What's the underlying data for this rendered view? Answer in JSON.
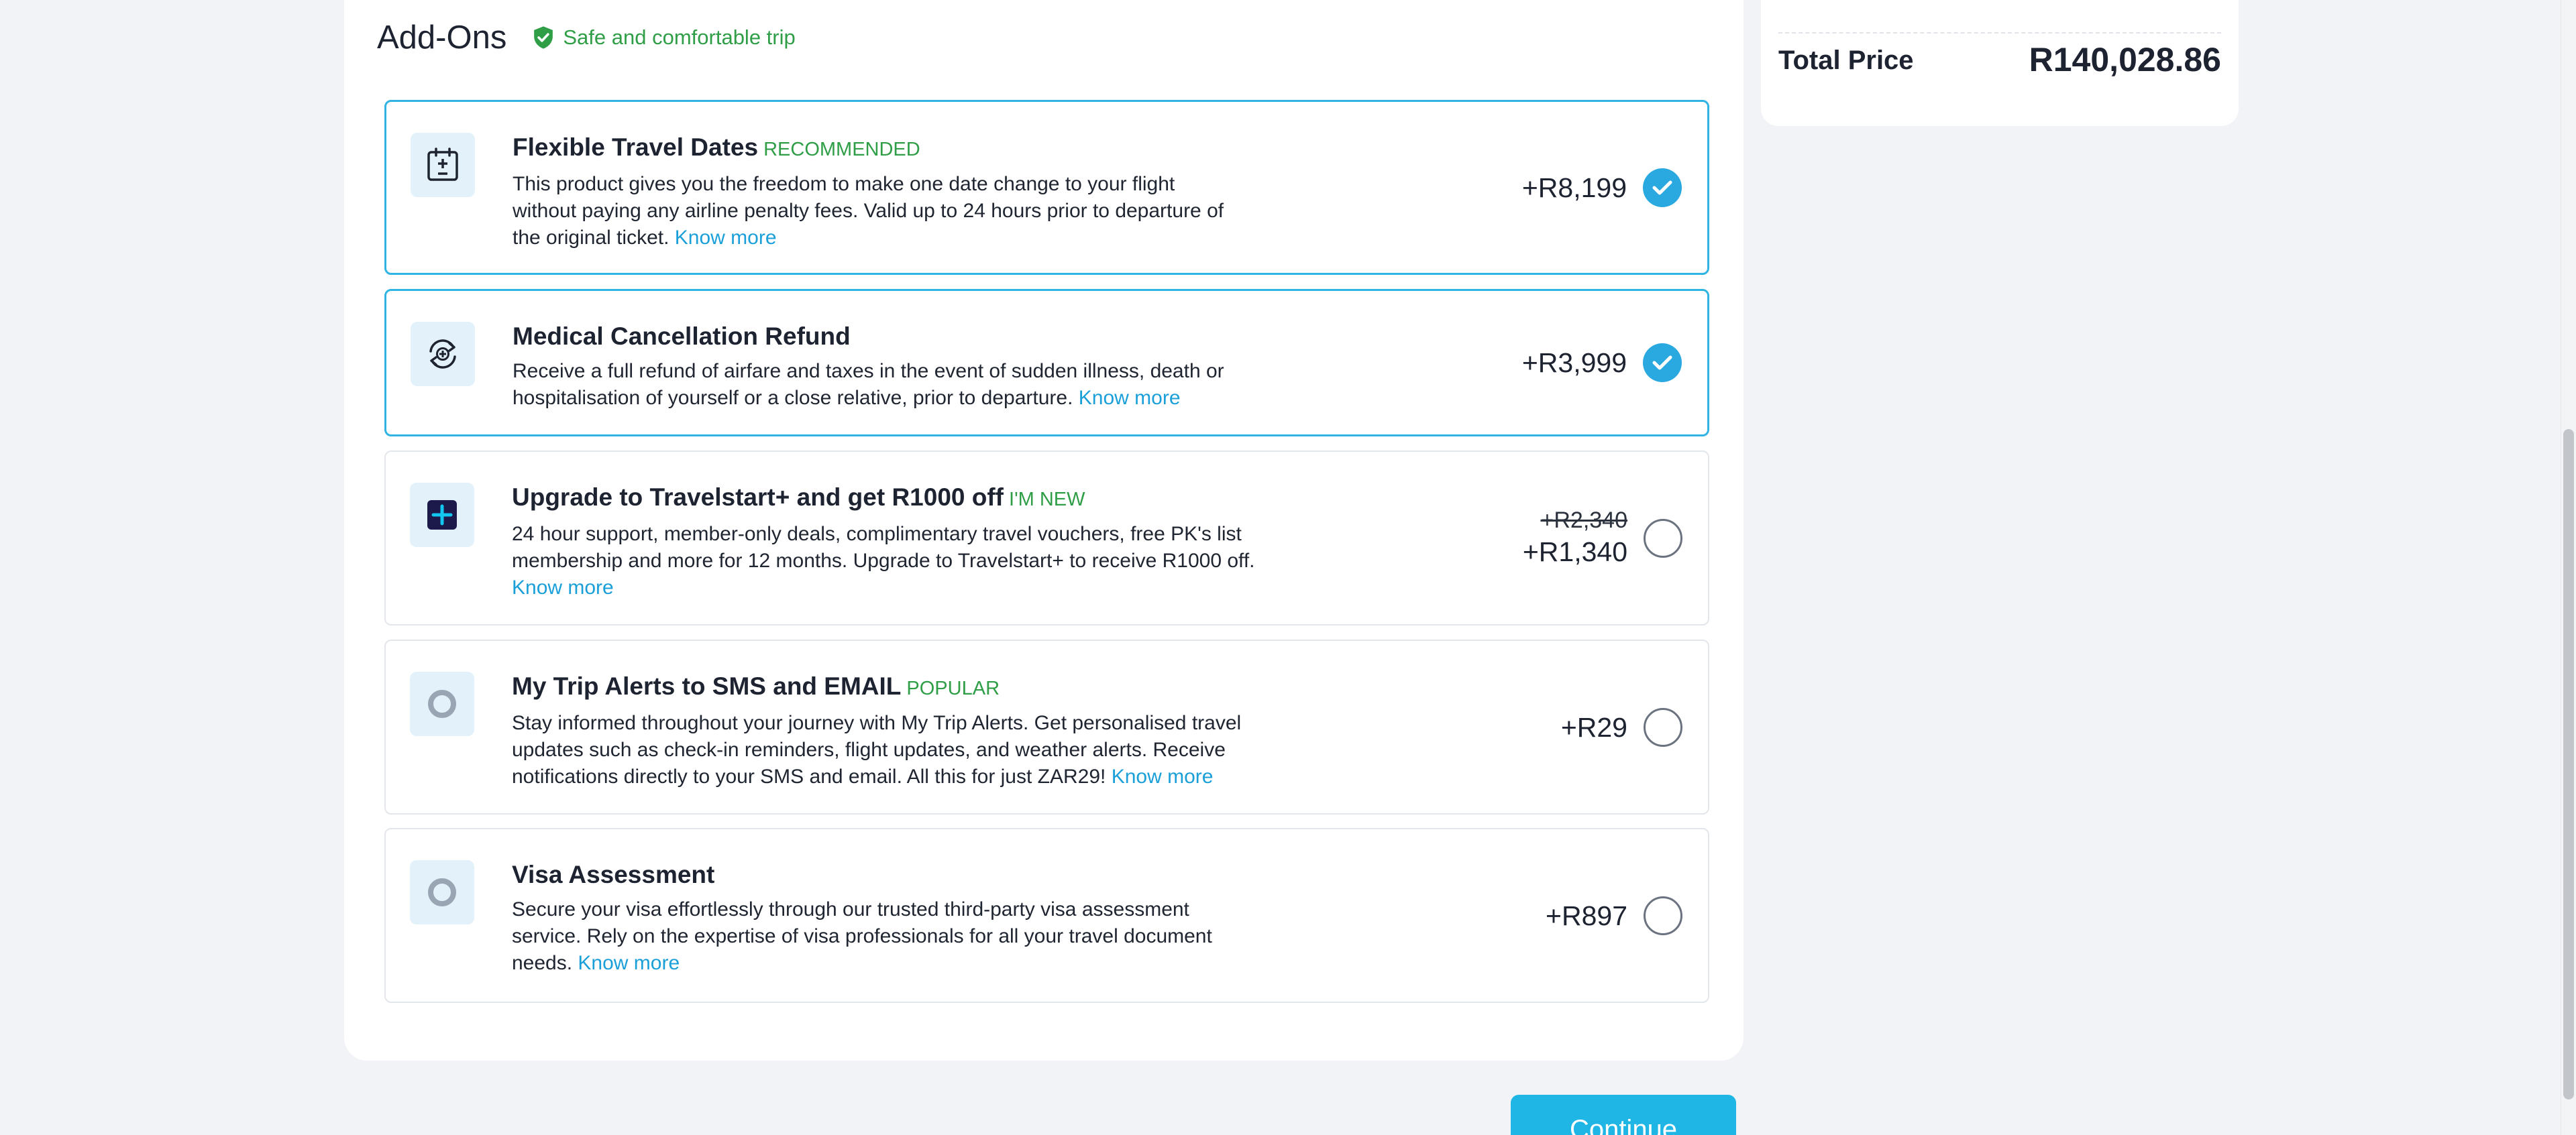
{
  "addons": {
    "title": "Add-Ons",
    "safe_label": "Safe and comfortable trip",
    "know_more": "Know more",
    "items": [
      {
        "title": "Flexible Travel Dates",
        "tag": "RECOMMENDED",
        "description": "This product gives you the freedom to make one date change to your flight without paying any airline penalty fees. Valid up to 24 hours prior to departure of the original ticket.",
        "price": "+R8,199",
        "selected": true,
        "icon": "calendar-plus-minus-icon"
      },
      {
        "title": "Medical Cancellation Refund",
        "tag": "",
        "description": "Receive a full refund of airfare and taxes in the event of sudden illness, death or hospitalisation of yourself or a close relative, prior to departure.",
        "price": "+R3,999",
        "selected": true,
        "icon": "medical-refresh-icon"
      },
      {
        "title": "Upgrade to Travelstart+ and get R1000 off",
        "tag": "I'M NEW",
        "description": "24 hour support, member-only deals, complimentary travel vouchers, free PK's list membership and more for 12 months. Upgrade to Travelstart+ to receive R1000 off.",
        "old_price": "+R2,340",
        "price": "+R1,340",
        "selected": false,
        "icon": "travelstart-plus-icon"
      },
      {
        "title": "My Trip Alerts to SMS and EMAIL",
        "tag": "POPULAR",
        "description": "Stay informed throughout your journey with My Trip Alerts. Get personalised travel updates such as check-in reminders, flight updates, and weather alerts. Receive notifications directly to your SMS and email. All this for just ZAR29!",
        "price": "+R29",
        "selected": false,
        "icon": "ring-icon"
      },
      {
        "title": "Visa Assessment",
        "tag": "",
        "description": "Secure your visa effortlessly through our trusted third-party visa assessment service. Rely on the expertise of visa professionals for all your travel document needs.",
        "price": "+R897",
        "selected": false,
        "icon": "ring-icon"
      }
    ]
  },
  "summary": {
    "total_label": "Total Price",
    "total_value": "R140,028.86"
  },
  "actions": {
    "continue_label": "Continue"
  },
  "colors": {
    "accent": "#2aa8e0",
    "tag_green": "#2f9e47",
    "link": "#1a9fd9",
    "background": "#f1f3f7"
  }
}
